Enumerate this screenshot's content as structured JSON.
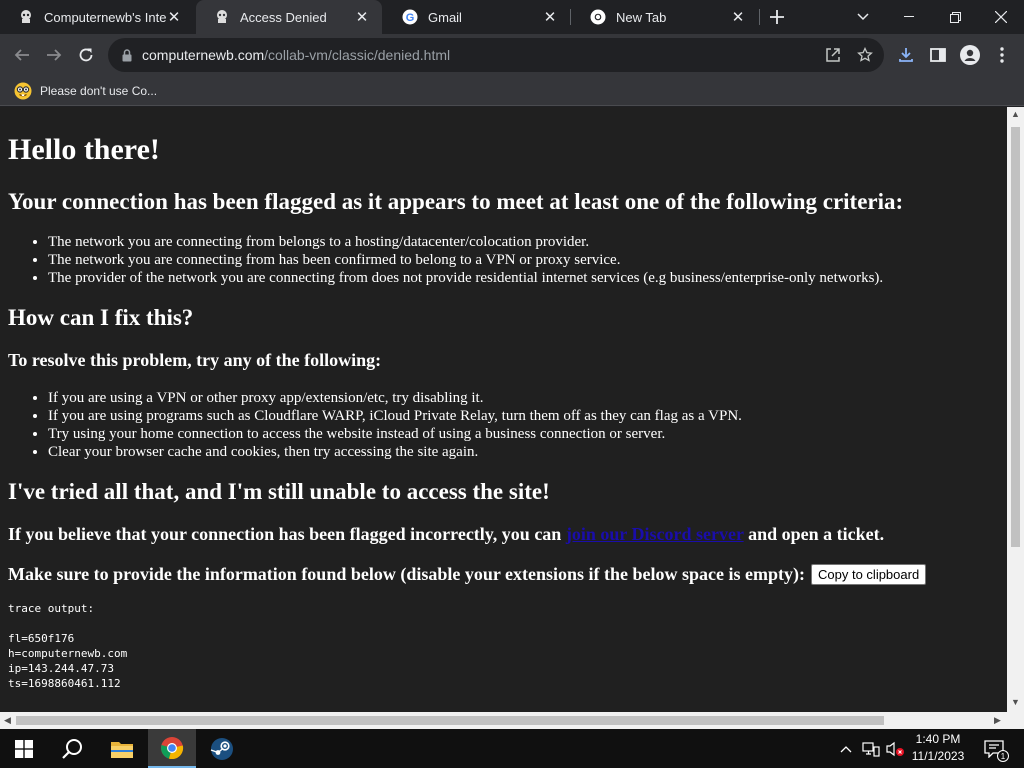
{
  "tabs": [
    {
      "title": "Computernewb's Inter",
      "icon": "computernewb-favicon"
    },
    {
      "title": "Access Denied",
      "icon": "computernewb-favicon",
      "active": true
    },
    {
      "title": "Gmail",
      "icon": "google-favicon"
    },
    {
      "title": "New Tab",
      "icon": "chrome-favicon"
    }
  ],
  "toolbar": {
    "url_host": "computernewb.com",
    "url_path": "/collab-vm/classic/denied.html"
  },
  "bookmarks": [
    {
      "label": "Please don't use Co...",
      "icon": "nerd-face-emoji"
    }
  ],
  "page": {
    "heading": "Hello there!",
    "flagged_heading": "Your connection has been flagged as it appears to meet at least one of the following criteria:",
    "criteria": [
      "The network you are connecting from belongs to a hosting/datacenter/colocation provider.",
      "The network you are connecting from has been confirmed to belong to a VPN or proxy service.",
      "The provider of the network you are connecting from does not provide residential internet services (e.g business/enterprise-only networks)."
    ],
    "fix_heading": "How can I fix this?",
    "resolve_heading": "To resolve this problem, try any of the following:",
    "fixes": [
      "If you are using a VPN or other proxy app/extension/etc, try disabling it.",
      "If you are using programs such as Cloudflare WARP, iCloud Private Relay, turn them off as they can flag as a VPN.",
      "Try using your home connection to access the website instead of using a business connection or server.",
      "Clear your browser cache and cookies, then try accessing the site again."
    ],
    "tried_heading": "I've tried all that, and I'm still unable to access the site!",
    "believe_prefix": "If you believe that your connection has been flagged incorrectly, you can",
    "discord_link": "join our Discord server",
    "believe_suffix": "and open a ticket.",
    "provide_text": "Make sure to provide the information found below (disable your extensions if the below space is empty):",
    "copy_button": "Copy to clipboard",
    "trace_label": "trace output:",
    "trace_lines": [
      "fl=650f176",
      "h=computernewb.com",
      "ip=143.244.47.73",
      "ts=1698860461.112"
    ]
  },
  "taskbar": {
    "time": "1:40 PM",
    "date": "11/1/2023",
    "notification_count": "1"
  },
  "colors": {
    "link": "#1a0dab",
    "page_bg": "#202020",
    "chrome_dark": "#202124",
    "chrome_toolbar": "#35363a"
  }
}
